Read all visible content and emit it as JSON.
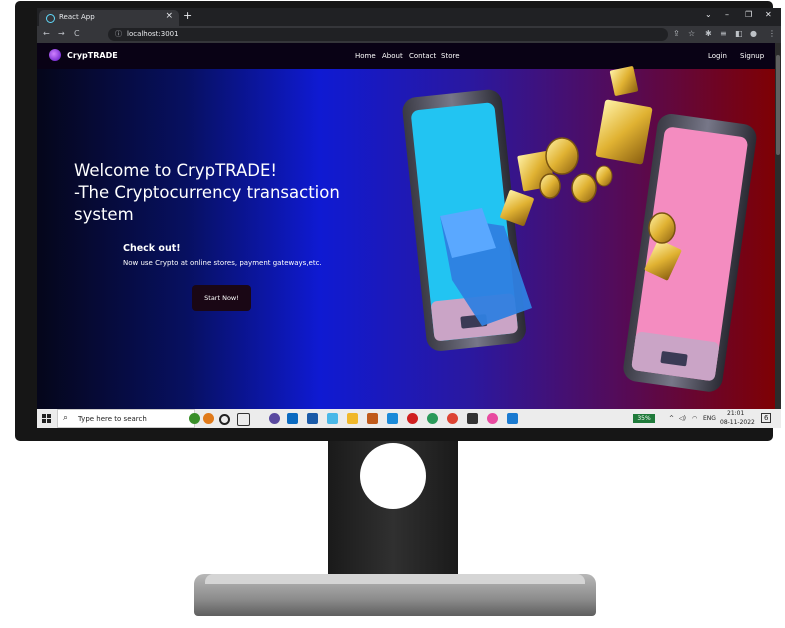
{
  "browser": {
    "tab_title": "React App",
    "tab_close": "×",
    "new_tab": "+",
    "url": "localhost:3001",
    "min": "–",
    "max": "❐",
    "close": "✕"
  },
  "navbar": {
    "brand": "CrypTRADE",
    "links": [
      "Home",
      "About",
      "Contact",
      "Store"
    ],
    "login": "Login",
    "signup": "Signup"
  },
  "hero": {
    "title_lines": [
      "Welcome to CrypTRADE!",
      "-The Cryptocurrency transaction",
      "system"
    ],
    "check_out": "Check out!",
    "subtitle": "Now use Crypto at online stores, payment gateways,etc.",
    "cta": "Start Now!"
  },
  "taskbar": {
    "search_placeholder": "Type here to search",
    "battery": "35%",
    "language": "ENG",
    "time": "21:01",
    "date": "08-11-2022",
    "notification_count": "6"
  },
  "colors": {
    "accent": "#0f1ad2",
    "navbar_bg": "#090215",
    "button_bg": "#1a0715"
  }
}
